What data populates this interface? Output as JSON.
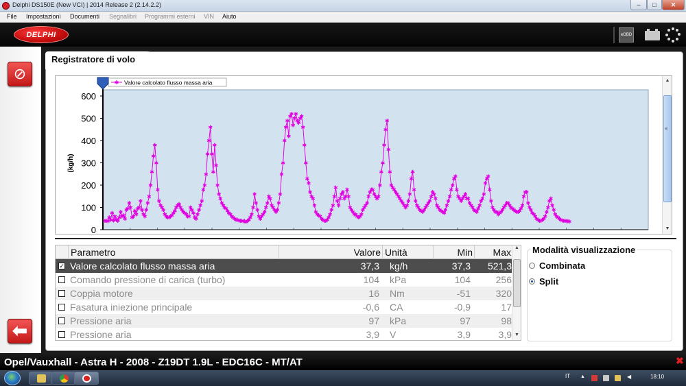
{
  "window": {
    "title": "Delphi DS150E (New VCI) | 2014 Release 2 (2.14.2.2)",
    "minimize_glyph": "–",
    "maximize_glyph": "□",
    "close_glyph": "✕"
  },
  "menu": [
    {
      "label": "File",
      "enabled": true
    },
    {
      "label": "Impostazioni",
      "enabled": true
    },
    {
      "label": "Documenti",
      "enabled": true
    },
    {
      "label": "Segnalibri",
      "enabled": false
    },
    {
      "label": "Programmi esterni",
      "enabled": false
    },
    {
      "label": "VIN",
      "enabled": false
    },
    {
      "label": "Aiuto",
      "enabled": true
    }
  ],
  "header": {
    "logo_text": "DELPHI",
    "obd_label": "eOBD",
    "icons": [
      "obd-icon",
      "battery-icon",
      "busy-spinner-icon"
    ]
  },
  "sidebar": {
    "top_button_icon": "clear-record-icon",
    "bottom_button_icon": "back-arrow-icon"
  },
  "panel": {
    "title": "Registratore di volo"
  },
  "chart_data": {
    "type": "line",
    "ylabel": "(kg/h)",
    "yticks": [
      0,
      100,
      200,
      300,
      400,
      500,
      600
    ],
    "ylim": [
      0,
      600
    ],
    "grid": true,
    "legend": "top-left",
    "series": [
      {
        "name": "Valore calcolato flusso massa aria",
        "color": "#e000e0",
        "marker": "asterisk",
        "values": [
          40,
          40,
          38,
          55,
          45,
          75,
          42,
          60,
          45,
          40,
          55,
          80,
          60,
          65,
          50,
          90,
          95,
          120,
          100,
          55,
          60,
          85,
          70,
          95,
          100,
          130,
          90,
          70,
          60,
          90,
          120,
          150,
          200,
          260,
          330,
          380,
          300,
          180,
          130,
          110,
          100,
          90,
          70,
          60,
          55,
          55,
          60,
          65,
          75,
          85,
          100,
          110,
          115,
          100,
          90,
          80,
          75,
          70,
          60,
          60,
          100,
          90,
          75,
          55,
          50,
          70,
          90,
          110,
          130,
          180,
          200,
          250,
          340,
          400,
          460,
          340,
          260,
          380,
          290,
          200,
          160,
          140,
          120,
          110,
          100,
          95,
          85,
          75,
          70,
          60,
          55,
          50,
          45,
          45,
          42,
          40,
          40,
          38,
          38,
          36,
          40,
          45,
          55,
          70,
          100,
          160,
          120,
          90,
          60,
          50,
          60,
          70,
          80,
          100,
          120,
          150,
          140,
          110,
          100,
          90,
          80,
          90,
          120,
          160,
          250,
          300,
          400,
          460,
          490,
          420,
          510,
          520,
          470,
          500,
          520,
          490,
          480,
          500,
          510,
          460,
          380,
          300,
          230,
          210,
          170,
          150,
          140,
          110,
          80,
          70,
          65,
          60,
          50,
          45,
          40,
          40,
          45,
          55,
          70,
          90,
          110,
          150,
          190,
          130,
          110,
          140,
          160,
          170,
          140,
          150,
          180,
          150,
          100,
          90,
          80,
          70,
          70,
          60,
          55,
          60,
          70,
          90,
          100,
          110,
          120,
          150,
          170,
          180,
          180,
          160,
          150,
          140,
          150,
          200,
          260,
          300,
          380,
          450,
          490,
          360,
          260,
          200,
          190,
          180,
          170,
          160,
          150,
          140,
          130,
          120,
          110,
          100,
          110,
          130,
          160,
          230,
          260,
          180,
          130,
          110,
          100,
          90,
          85,
          80,
          90,
          100,
          110,
          120,
          130,
          150,
          170,
          160,
          140,
          110,
          100,
          90,
          85,
          80,
          75,
          90,
          110,
          130,
          150,
          180,
          200,
          230,
          240,
          180,
          150,
          140,
          130,
          140,
          150,
          160,
          140,
          140,
          120,
          110,
          100,
          90,
          85,
          80,
          95,
          110,
          130,
          140,
          160,
          210,
          230,
          240,
          180,
          130,
          100,
          90,
          80,
          80,
          70,
          75,
          80,
          90,
          100,
          110,
          120,
          120,
          110,
          100,
          95,
          90,
          85,
          80,
          80,
          85,
          95,
          110,
          150,
          170,
          170,
          120,
          100,
          90,
          75,
          70,
          60,
          50,
          45,
          40,
          40,
          45,
          50,
          60,
          80,
          100,
          130,
          140,
          110,
          90,
          70,
          60,
          55,
          50,
          45,
          42,
          40,
          40,
          38,
          38,
          37
        ]
      }
    ]
  },
  "table": {
    "headers": [
      "Parametro",
      "Valore",
      "Unità",
      "Min",
      "Max"
    ],
    "rows": [
      {
        "checked": "✓",
        "name": "Valore calcolato flusso massa aria",
        "value": "37,3",
        "unit": "kg/h",
        "min": "37,3",
        "max": "521,3"
      },
      {
        "checked": "",
        "name": "Comando pressione di carica (turbo)",
        "value": "104",
        "unit": "kPa",
        "min": "104",
        "max": "256"
      },
      {
        "checked": "",
        "name": "Coppia motore",
        "value": "16",
        "unit": "Nm",
        "min": "-51",
        "max": "320"
      },
      {
        "checked": "",
        "name": "Fasatura iniezione principale",
        "value": "-0,6",
        "unit": "CA",
        "min": "-0,9",
        "max": "17"
      },
      {
        "checked": "",
        "name": "Pressione aria",
        "value": "97",
        "unit": "kPa",
        "min": "97",
        "max": "98"
      },
      {
        "checked": "",
        "name": "Pressione aria",
        "value": "3,9",
        "unit": "V",
        "min": "3,9",
        "max": "3,9"
      }
    ]
  },
  "display_mode": {
    "title": "Modalità visualizzazione",
    "options": [
      {
        "label": "Combinata",
        "selected": false
      },
      {
        "label": "Split",
        "selected": true
      }
    ]
  },
  "vehicle": {
    "info": "Opel/Vauxhall - Astra H - 2008 - Z19DT 1.9L - EDC16C - MT/AT",
    "close_glyph": "✖"
  },
  "taskbar": {
    "apps": [
      "windows-explorer-icon",
      "chrome-icon",
      "delphi-app-icon"
    ],
    "language": "IT",
    "clock": "18:10"
  }
}
